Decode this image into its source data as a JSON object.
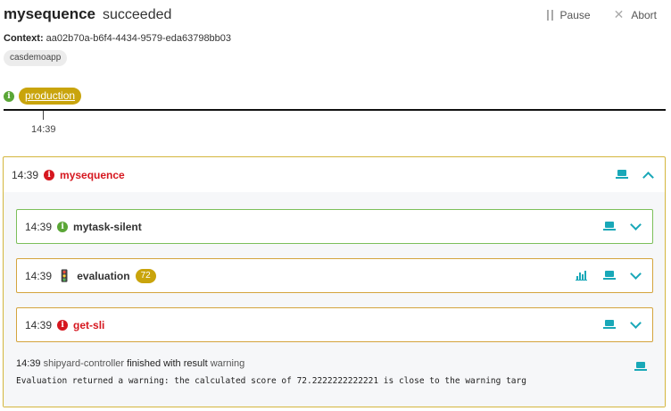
{
  "sequence": {
    "name": "mysequence",
    "status": "succeeded"
  },
  "header_actions": {
    "pause_label": "Pause",
    "abort_label": "Abort"
  },
  "context": {
    "label": "Context:",
    "id": "aa02b70a-b6f4-4434-9579-eda63798bb03"
  },
  "tag": "casdemoapp",
  "stage": {
    "name": "production"
  },
  "timeline": {
    "tick_label": "14:39"
  },
  "event": {
    "time": "14:39",
    "name": "mysequence",
    "tasks": [
      {
        "time": "14:39",
        "name": "mytask-silent",
        "status": "success"
      },
      {
        "time": "14:39",
        "name": "evaluation",
        "score": "72",
        "status": "warning"
      },
      {
        "time": "14:39",
        "name": "get-sli",
        "status": "error"
      }
    ],
    "log": {
      "time": "14:39",
      "source": "shipyard-controller",
      "text": "finished with result",
      "result": "warning",
      "message": "Evaluation returned a warning: the calculated score of 72.2222222222221 is close to the warning targ"
    }
  },
  "colors": {
    "accent": "#19a8b8",
    "warning": "#c9a40c",
    "error": "#d6171f",
    "success": "#5aa636"
  }
}
